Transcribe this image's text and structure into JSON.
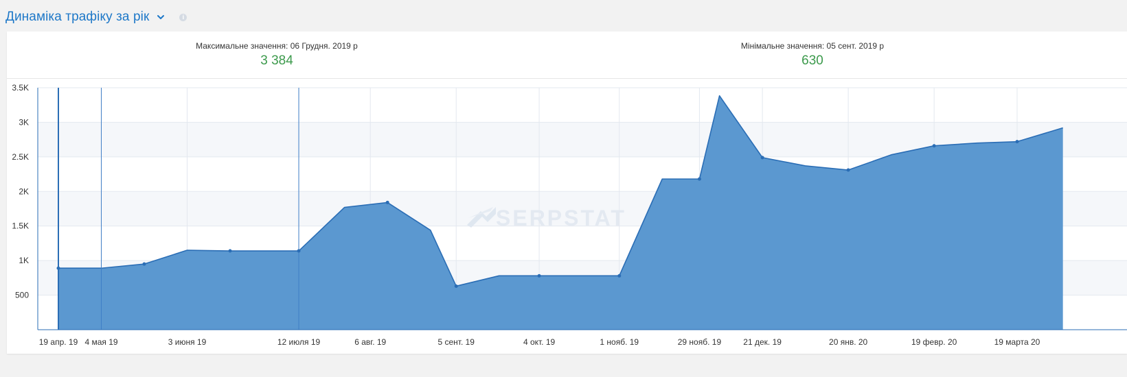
{
  "header": {
    "title": "Динаміка трафіку за рік",
    "info_glyph": "i"
  },
  "stats": {
    "max_label": "Максимальне значення: 06 Грудня. 2019 р",
    "max_value": "3 384",
    "min_label": "Мінімальне значення: 05 сент. 2019 р",
    "min_value": "630"
  },
  "watermark": "SERPSTAT",
  "colors": {
    "accent": "#1e78c8",
    "area_fill": "#5b98d0",
    "area_line": "#2a6db5",
    "value_green": "#3c9a4c"
  },
  "chart_data": {
    "type": "area",
    "title": "",
    "xlabel": "",
    "ylabel": "",
    "ylim": [
      0,
      3500
    ],
    "y_ticks": [
      {
        "value": 3500,
        "label": "3.5K"
      },
      {
        "value": 3000,
        "label": "3K"
      },
      {
        "value": 2500,
        "label": "2.5K"
      },
      {
        "value": 2000,
        "label": "2K"
      },
      {
        "value": 1500,
        "label": "1.5K"
      },
      {
        "value": 1000,
        "label": "1K"
      },
      {
        "value": 500,
        "label": "500"
      }
    ],
    "x_ticks": [
      {
        "date": "2019-04-19",
        "label": "19 апр. 19"
      },
      {
        "date": "2019-05-04",
        "label": "4 мая 19"
      },
      {
        "date": "2019-06-03",
        "label": "3 июня 19"
      },
      {
        "date": "2019-07-12",
        "label": "12 июля 19"
      },
      {
        "date": "2019-08-06",
        "label": "6 авг. 19"
      },
      {
        "date": "2019-09-05",
        "label": "5 сент. 19"
      },
      {
        "date": "2019-10-04",
        "label": "4 окт. 19"
      },
      {
        "date": "2019-11-01",
        "label": "1 нояб. 19"
      },
      {
        "date": "2019-11-29",
        "label": "29 нояб. 19"
      },
      {
        "date": "2019-12-21",
        "label": "21 дек. 19"
      },
      {
        "date": "2020-01-20",
        "label": "20 янв. 20"
      },
      {
        "date": "2020-02-19",
        "label": "19 февр. 20"
      },
      {
        "date": "2020-03-19",
        "label": "19 марта 20"
      }
    ],
    "series": [
      {
        "points": [
          {
            "date": "2019-04-19",
            "y": 890,
            "marker": true
          },
          {
            "date": "2019-05-04",
            "y": 890,
            "marker": false
          },
          {
            "date": "2019-05-19",
            "y": 950,
            "marker": true
          },
          {
            "date": "2019-06-03",
            "y": 1150,
            "marker": false
          },
          {
            "date": "2019-06-18",
            "y": 1140,
            "marker": true
          },
          {
            "date": "2019-07-03",
            "y": 1140,
            "marker": false
          },
          {
            "date": "2019-07-12",
            "y": 1140,
            "marker": true
          },
          {
            "date": "2019-07-28",
            "y": 1770,
            "marker": false
          },
          {
            "date": "2019-08-12",
            "y": 1840,
            "marker": true
          },
          {
            "date": "2019-08-27",
            "y": 1440,
            "marker": false
          },
          {
            "date": "2019-09-05",
            "y": 630,
            "marker": true
          },
          {
            "date": "2019-09-20",
            "y": 780,
            "marker": false
          },
          {
            "date": "2019-10-04",
            "y": 780,
            "marker": true
          },
          {
            "date": "2019-10-19",
            "y": 780,
            "marker": false
          },
          {
            "date": "2019-11-01",
            "y": 780,
            "marker": true
          },
          {
            "date": "2019-11-16",
            "y": 2180,
            "marker": false
          },
          {
            "date": "2019-11-29",
            "y": 2180,
            "marker": true
          },
          {
            "date": "2019-12-06",
            "y": 3384,
            "marker": false
          },
          {
            "date": "2019-12-21",
            "y": 2490,
            "marker": true
          },
          {
            "date": "2020-01-05",
            "y": 2370,
            "marker": false
          },
          {
            "date": "2020-01-20",
            "y": 2310,
            "marker": true
          },
          {
            "date": "2020-02-04",
            "y": 2530,
            "marker": false
          },
          {
            "date": "2020-02-19",
            "y": 2660,
            "marker": true
          },
          {
            "date": "2020-03-05",
            "y": 2700,
            "marker": false
          },
          {
            "date": "2020-03-19",
            "y": 2720,
            "marker": true
          },
          {
            "date": "2020-04-04",
            "y": 2920,
            "marker": false
          }
        ]
      }
    ],
    "marker_lines": [
      "2019-04-19",
      "2019-05-04",
      "2019-07-12"
    ],
    "grid": true,
    "legend": "none"
  }
}
